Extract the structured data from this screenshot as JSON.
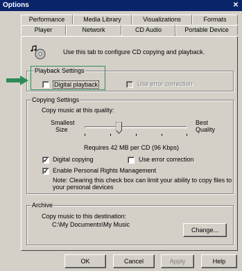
{
  "window": {
    "title": "Options",
    "close_glyph": "✕"
  },
  "tabs": {
    "back_row": [
      "Performance",
      "Media Library",
      "Visualizations",
      "Formats"
    ],
    "front_row": [
      "Player",
      "Network",
      "CD Audio",
      "Portable Device"
    ],
    "active": "CD Audio"
  },
  "intro": {
    "icon": "cd-music-icon",
    "text": "Use this tab to configure CD copying and playback."
  },
  "playback": {
    "title": "Playback Settings",
    "digital_playback": {
      "label": "Digital playback",
      "checked": false
    },
    "error_correction": {
      "label": "Use error correction",
      "checked": false,
      "enabled": false
    }
  },
  "copying": {
    "title": "Copying Settings",
    "quality_label": "Copy music at this quality:",
    "min_label_1": "Smallest",
    "min_label_2": "Size",
    "max_label_1": "Best",
    "max_label_2": "Quality",
    "slider_level": 0.33,
    "requirement": "Requires 42 MB per CD (96 Kbps)",
    "digital_copying": {
      "label": "Digital copying",
      "checked": true
    },
    "copy_error_correction": {
      "label": "Use error correction",
      "checked": false
    },
    "drm": {
      "label": "Enable Personal Rights Management",
      "checked": true
    },
    "note_1": "Note: Clearing this check box can limit your ability to copy files to",
    "note_2": "your personal devices"
  },
  "archive": {
    "title": "Archive",
    "dest_label": "Copy music to this destination:",
    "path": "C:\\My Documents\\My Music",
    "change_button": "Change..."
  },
  "footer": {
    "ok": "OK",
    "cancel": "Cancel",
    "apply": "Apply",
    "help": "Help"
  },
  "colors": {
    "titlebar": "#0a246a",
    "dialog": "#d4d0c8",
    "callout": "#2e8b57"
  },
  "callout_icon": "green-arrow-icon"
}
